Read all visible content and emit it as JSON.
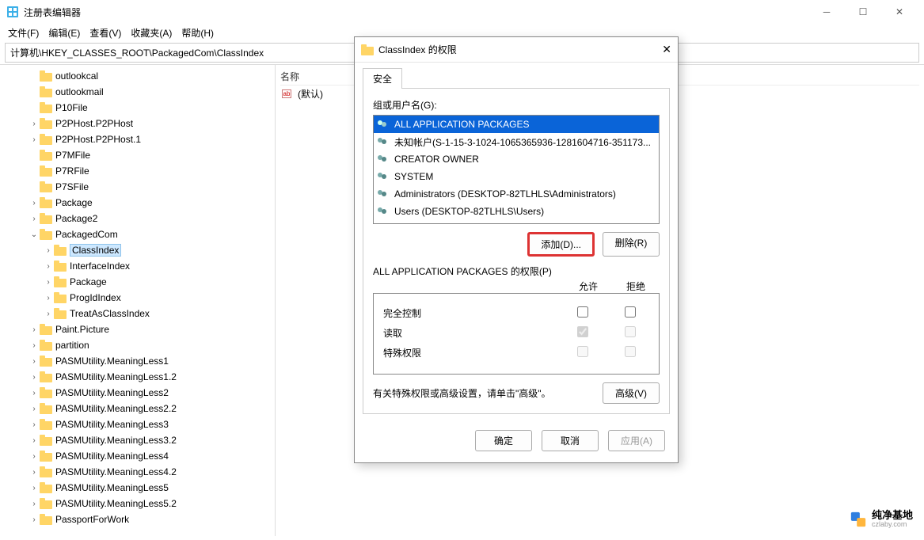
{
  "window": {
    "title": "注册表编辑器",
    "path": "计算机\\HKEY_CLASSES_ROOT\\PackagedCom\\ClassIndex"
  },
  "menu": {
    "file": "文件(F)",
    "edit": "编辑(E)",
    "view": "查看(V)",
    "fav": "收藏夹(A)",
    "help": "帮助(H)"
  },
  "tree": [
    {
      "indent": 2,
      "chev": "",
      "label": "outlookcal"
    },
    {
      "indent": 2,
      "chev": "",
      "label": "outlookmail"
    },
    {
      "indent": 2,
      "chev": "",
      "label": "P10File"
    },
    {
      "indent": 2,
      "chev": ">",
      "label": "P2PHost.P2PHost"
    },
    {
      "indent": 2,
      "chev": ">",
      "label": "P2PHost.P2PHost.1"
    },
    {
      "indent": 2,
      "chev": "",
      "label": "P7MFile"
    },
    {
      "indent": 2,
      "chev": "",
      "label": "P7RFile"
    },
    {
      "indent": 2,
      "chev": "",
      "label": "P7SFile"
    },
    {
      "indent": 2,
      "chev": ">",
      "label": "Package"
    },
    {
      "indent": 2,
      "chev": ">",
      "label": "Package2"
    },
    {
      "indent": 2,
      "chev": "v",
      "label": "PackagedCom"
    },
    {
      "indent": 3,
      "chev": ">",
      "label": "ClassIndex",
      "selected": true
    },
    {
      "indent": 3,
      "chev": ">",
      "label": "InterfaceIndex"
    },
    {
      "indent": 3,
      "chev": ">",
      "label": "Package"
    },
    {
      "indent": 3,
      "chev": ">",
      "label": "ProgIdIndex"
    },
    {
      "indent": 3,
      "chev": ">",
      "label": "TreatAsClassIndex"
    },
    {
      "indent": 2,
      "chev": ">",
      "label": "Paint.Picture"
    },
    {
      "indent": 2,
      "chev": ">",
      "label": "partition"
    },
    {
      "indent": 2,
      "chev": ">",
      "label": "PASMUtility.MeaningLess1"
    },
    {
      "indent": 2,
      "chev": ">",
      "label": "PASMUtility.MeaningLess1.2"
    },
    {
      "indent": 2,
      "chev": ">",
      "label": "PASMUtility.MeaningLess2"
    },
    {
      "indent": 2,
      "chev": ">",
      "label": "PASMUtility.MeaningLess2.2"
    },
    {
      "indent": 2,
      "chev": ">",
      "label": "PASMUtility.MeaningLess3"
    },
    {
      "indent": 2,
      "chev": ">",
      "label": "PASMUtility.MeaningLess3.2"
    },
    {
      "indent": 2,
      "chev": ">",
      "label": "PASMUtility.MeaningLess4"
    },
    {
      "indent": 2,
      "chev": ">",
      "label": "PASMUtility.MeaningLess4.2"
    },
    {
      "indent": 2,
      "chev": ">",
      "label": "PASMUtility.MeaningLess5"
    },
    {
      "indent": 2,
      "chev": ">",
      "label": "PASMUtility.MeaningLess5.2"
    },
    {
      "indent": 2,
      "chev": ">",
      "label": "PassportForWork"
    }
  ],
  "rightpane": {
    "header_name": "名称",
    "default_value": "(默认)"
  },
  "dialog": {
    "title": "ClassIndex 的权限",
    "tab": "安全",
    "group_label": "组或用户名(G):",
    "groups": [
      {
        "label": "ALL APPLICATION PACKAGES",
        "selected": true
      },
      {
        "label": "未知帐户(S-1-15-3-1024-1065365936-1281604716-351173...",
        "selected": false
      },
      {
        "label": "CREATOR OWNER",
        "selected": false
      },
      {
        "label": "SYSTEM",
        "selected": false
      },
      {
        "label": "Administrators (DESKTOP-82TLHLS\\Administrators)",
        "selected": false
      },
      {
        "label": "Users (DESKTOP-82TLHLS\\Users)",
        "selected": false
      }
    ],
    "btn_add": "添加(D)...",
    "btn_remove": "删除(R)",
    "perm_for": "ALL APPLICATION PACKAGES 的权限(P)",
    "col_allow": "允许",
    "col_deny": "拒绝",
    "perms": [
      {
        "name": "完全控制",
        "allow": false,
        "deny": false,
        "disabled": false
      },
      {
        "name": "读取",
        "allow": true,
        "deny": false,
        "disabled": true
      },
      {
        "name": "特殊权限",
        "allow": false,
        "deny": false,
        "disabled": true
      }
    ],
    "adv_hint": "有关特殊权限或高级设置，请单击\"高级\"。",
    "btn_adv": "高级(V)",
    "btn_ok": "确定",
    "btn_cancel": "取消",
    "btn_apply": "应用(A)"
  },
  "watermark": {
    "text": "纯净基地",
    "sub": "czlaby.com"
  }
}
